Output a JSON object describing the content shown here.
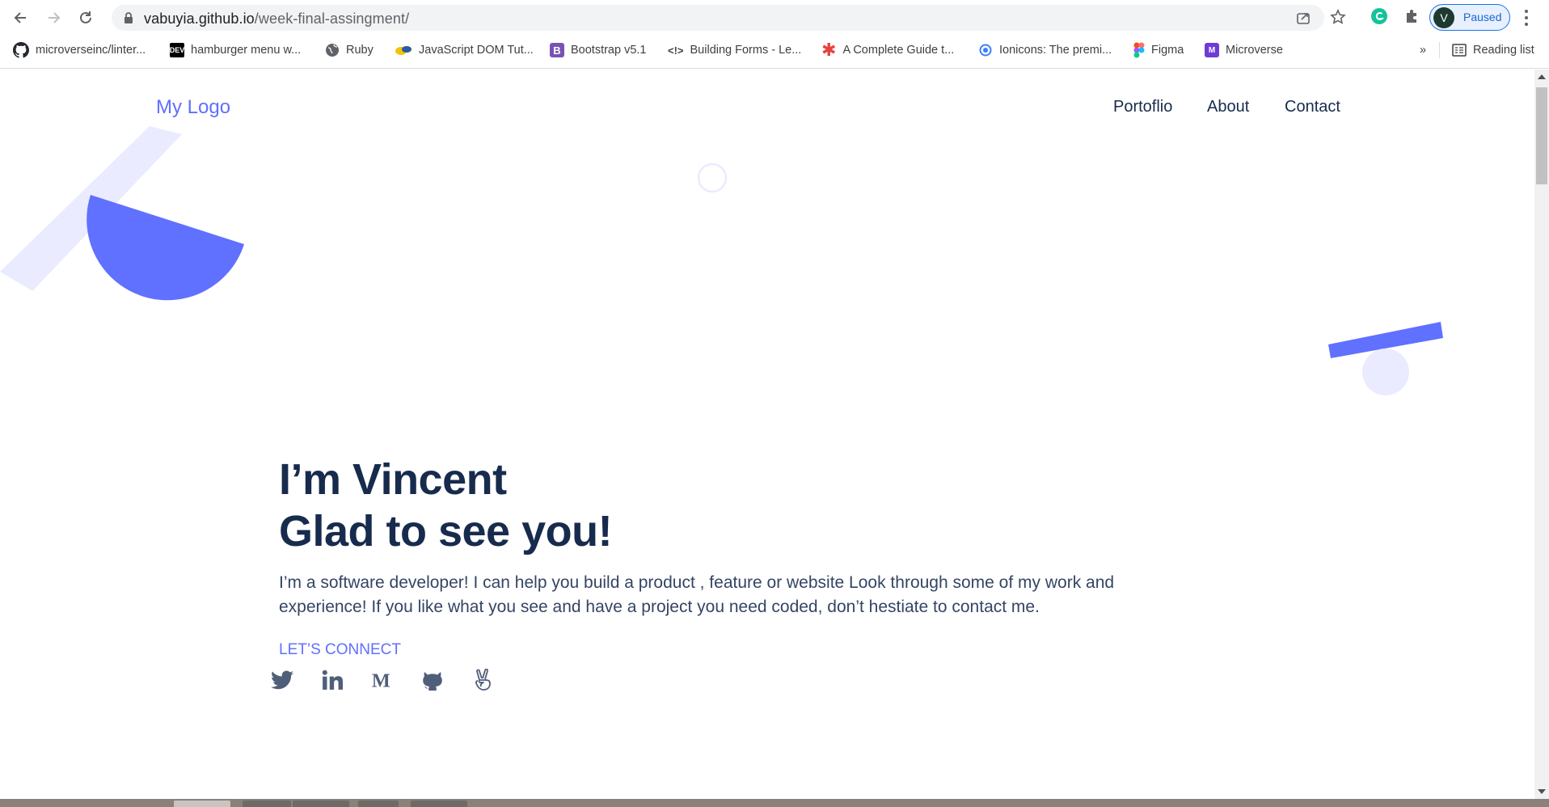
{
  "browser": {
    "url_host": "vabuyia.github.io",
    "url_path": "/week-final-assingment/",
    "profile_initial": "V",
    "profile_status": "Paused",
    "bookmarks": [
      {
        "label": "microverseinc/linter...",
        "icon": "github-icon"
      },
      {
        "label": "hamburger menu w...",
        "icon": "dev-icon"
      },
      {
        "label": "Ruby",
        "icon": "globe-icon"
      },
      {
        "label": "JavaScript DOM Tut...",
        "icon": "js-icon"
      },
      {
        "label": "Bootstrap v5.1",
        "icon": "bootstrap-icon"
      },
      {
        "label": "Building Forms - Le...",
        "icon": "code-icon"
      },
      {
        "label": "A Complete Guide t...",
        "icon": "asterisk-icon"
      },
      {
        "label": "Ionicons: The premi...",
        "icon": "ionicons-icon"
      },
      {
        "label": "Figma",
        "icon": "figma-icon"
      },
      {
        "label": "Microverse",
        "icon": "microverse-icon"
      }
    ],
    "bookmarks_overflow": "»",
    "reading_list": "Reading list"
  },
  "header": {
    "logo": "My Logo",
    "nav": [
      "Portoflio",
      "About",
      "Contact"
    ]
  },
  "hero": {
    "title_line1": "I’m Vincent",
    "title_line2": "Glad to see you!",
    "description": "I’m a software developer! I can help you build a product , feature or website Look through some of my work and experience! If you like what you see and have a project you need coded, don’t hestiate to contact me.",
    "connect_label": "LET’S CONNECT",
    "socials": [
      "twitter-icon",
      "linkedin-icon",
      "medium-icon",
      "github-icon",
      "angellist-icon"
    ]
  },
  "colors": {
    "accent": "#6070ff",
    "text_dark": "#172b4d",
    "shape_light": "#ebebff"
  }
}
